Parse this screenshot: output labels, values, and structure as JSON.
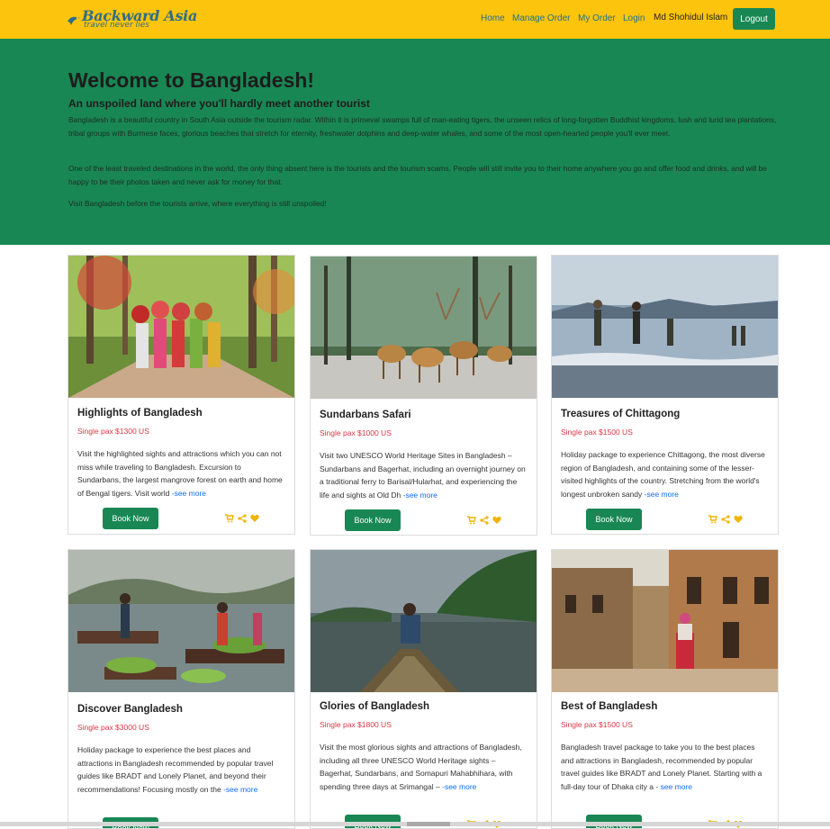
{
  "navbar": {
    "brand": "Backward Asia",
    "tagline": "travel never lies",
    "links": [
      "Home",
      "Manage Order",
      "My Order",
      "Login"
    ],
    "user": "Md Shohidul Islam",
    "logout": "Logout",
    "bg_color": "#fcc40c"
  },
  "hero": {
    "title": "Welcome to Bangladesh!",
    "subtitle": "An unspoiled land where you'll hardly meet another tourist",
    "paragraphs": [
      "Bangladesh is a beautiful country in South Asia outside the tourism radar. Within it is primeval swamps full of man-eating tigers, the unseen relics of long-forgotten Buddhist kingdoms, lush and lurid tea plantations, tribal groups with Burmese faces, glorious beaches that stretch for eternity, freshwater dolphins and deep-water whales, and some of the most open-hearted people you'll ever meet.",
      "One of the least traveled destinations in the world, the only thing absent here is the tourists and the tourism scams. People will still invite you to their home anywhere you go and offer food and drinks, and will be happy to be their photos taken and never ask for money for that.",
      "Visit Bangladesh before the tourists arrive, where everything is still unspoiled!"
    ],
    "bg_color": "#198754"
  },
  "packages": [
    {
      "title": "Highlights of Bangladesh",
      "price": "Single pax $1300 US",
      "description": "Visit the highlighted sights and attractions which you can not miss while traveling to Bangladesh. Excursion to Sundarbans, the largest mangrove forest on earth and home of Bengal tigers. Visit world",
      "more": "-see more",
      "book": "Book Now",
      "image": "women carrying bundles on a forest path"
    },
    {
      "title": "Sundarbans Safari",
      "price": "Single pax $1000 US",
      "description": "Visit two UNESCO World Heritage Sites in Bangladesh – Sundarbans and Bagerhat, including an overnight journey on a traditional ferry to Barisal/Hularhat, and experiencing the life and sights at Old Dh",
      "more": "-see more",
      "book": "Book Now",
      "image": "spotted deer herd in the Sundarbans"
    },
    {
      "title": "Treasures of Chittagong",
      "price": "Single pax $1500 US",
      "description": "Holiday package to experience Chittagong, the most diverse region of Bangladesh, and containing some of the lesser-visited highlights of the country. Stretching from the world's longest unbroken sandy",
      "more": "-see more",
      "book": "Book Now",
      "image": "fishermen wading at a beach"
    },
    {
      "title": "Discover Bangladesh",
      "price": "Single pax $3000 US",
      "description": "Holiday package to experience the best places and attractions in Bangladesh recommended by popular travel guides like BRADT and Lonely Planet, and beyond their recommendations! Focusing mostly on the",
      "more": "-see more",
      "book": "Book Now",
      "image": "floating market boats with vegetables"
    },
    {
      "title": "Glories of Bangladesh",
      "price": "Single pax $1800 US",
      "description": "Visit the most glorious sights and attractions of Bangladesh, including all three UNESCO World Heritage sights – Bagerhat, Sundarbans, and Somapuri Mahabhihara, with spending three days at Srimangal –",
      "more": "-see more",
      "book": "Book Now",
      "image": "man sitting on a boat on a river"
    },
    {
      "title": "Best of Bangladesh",
      "price": "Single pax $1500 US",
      "description": "Bangladesh travel package to take you to the best places and attractions in Bangladesh, recommended by popular travel guides like BRADT and Lonely Planet. Starting with a full-day tour of Dhaka city a -",
      "more": "see more",
      "book": "Book Now",
      "image": "woman walking past old ruined buildings"
    }
  ],
  "icons": [
    "cart-icon",
    "share-icon",
    "heart-icon"
  ],
  "colors": {
    "accent": "#198754",
    "price": "#dc3545",
    "link": "#0d6efd",
    "icon": "#f0b400"
  }
}
